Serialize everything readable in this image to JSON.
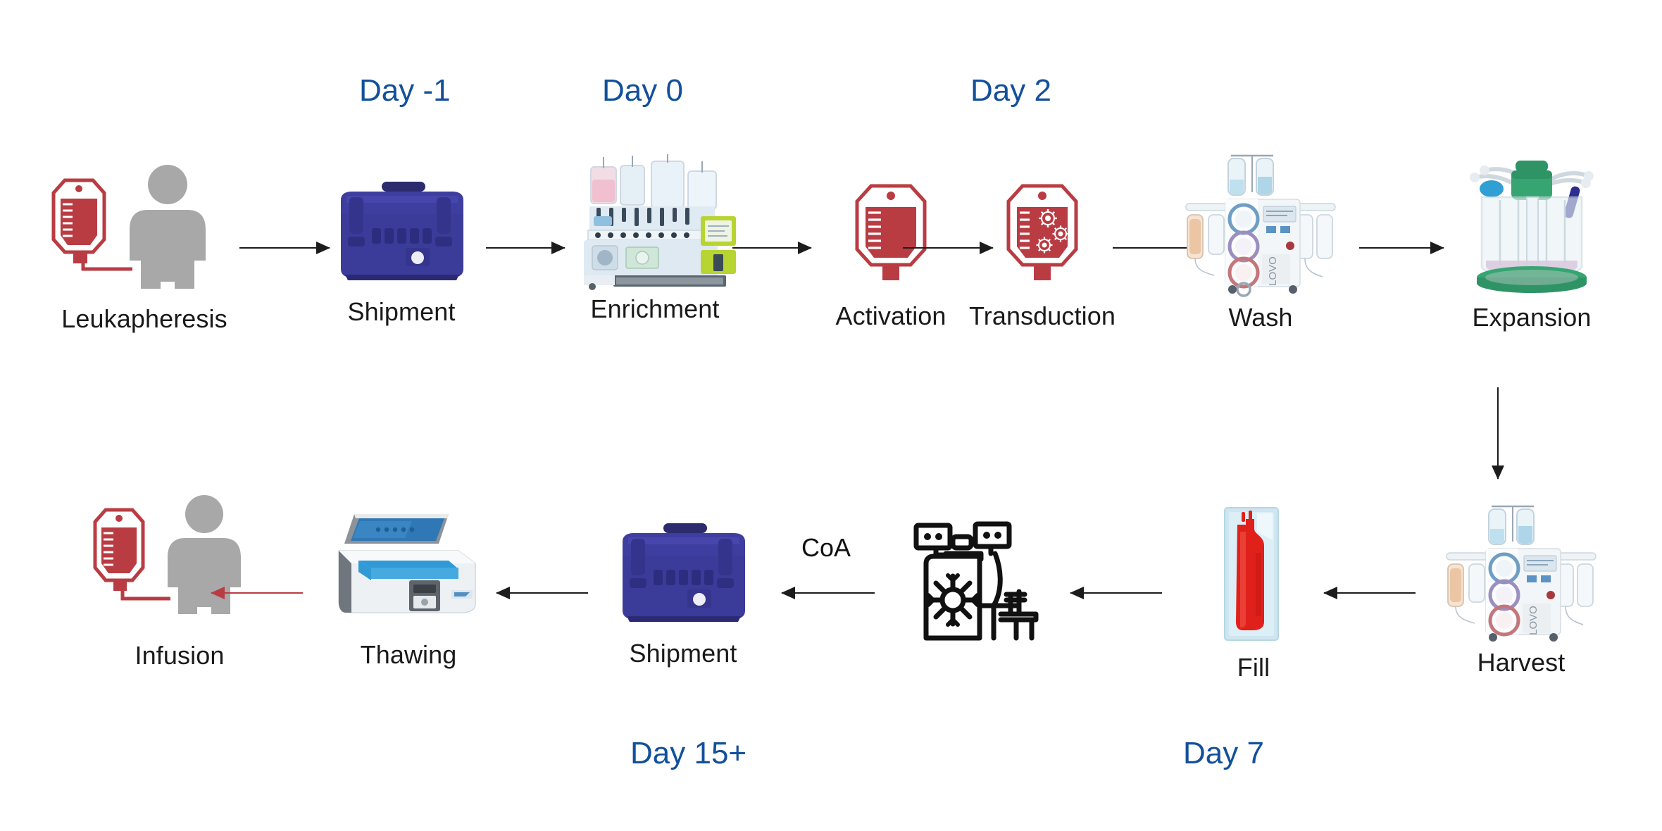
{
  "diagram": {
    "title_colors": {
      "day_label": "#12509b",
      "caption": "#1a1a1a",
      "arrow": "#1c1c1c",
      "red_arrow": "#b93c43"
    },
    "top_row": [
      {
        "id": "leukapheresis",
        "caption": "Leukapheresis",
        "icon": "blood-bag-and-patient-icon",
        "day": null
      },
      {
        "id": "shipment-out",
        "caption": "Shipment",
        "icon": "shipping-cooler-icon",
        "day": "Day -1"
      },
      {
        "id": "enrichment",
        "caption": "Enrichment",
        "icon": "cell-processing-system-icon",
        "day": "Day 0"
      },
      {
        "id": "activation",
        "caption": "Activation",
        "icon": "blood-bag-icon",
        "day": null
      },
      {
        "id": "transduction",
        "caption": "Transduction",
        "icon": "blood-bag-virus-icon",
        "day": "Day 2"
      },
      {
        "id": "wash",
        "caption": "Wash",
        "icon": "cell-washer-lovo-icon",
        "day": null
      },
      {
        "id": "expansion",
        "caption": "Expansion",
        "icon": "bioreactor-vessel-icon",
        "day": null
      }
    ],
    "bottom_row": [
      {
        "id": "infusion",
        "caption": "Infusion",
        "icon": "blood-bag-and-patient-icon",
        "day": null
      },
      {
        "id": "thawing",
        "caption": "Thawing",
        "icon": "thawing-device-icon",
        "day": null
      },
      {
        "id": "shipment-back",
        "caption": "Shipment",
        "icon": "shipping-cooler-icon",
        "day": "Day 15+"
      },
      {
        "id": "cryostorage",
        "caption": "",
        "icon": "cryo-freezer-icon",
        "day": null
      },
      {
        "id": "fill",
        "caption": "Fill",
        "icon": "cryobag-icon",
        "day": "Day 7"
      },
      {
        "id": "harvest",
        "caption": "Harvest",
        "icon": "cell-washer-lovo-icon",
        "day": null
      }
    ],
    "annotations": {
      "coa": "CoA"
    },
    "day_labels": {
      "day_minus1": "Day -1",
      "day_0": "Day 0",
      "day_2": "Day 2",
      "day_7": "Day 7",
      "day_15plus": "Day 15+"
    }
  }
}
